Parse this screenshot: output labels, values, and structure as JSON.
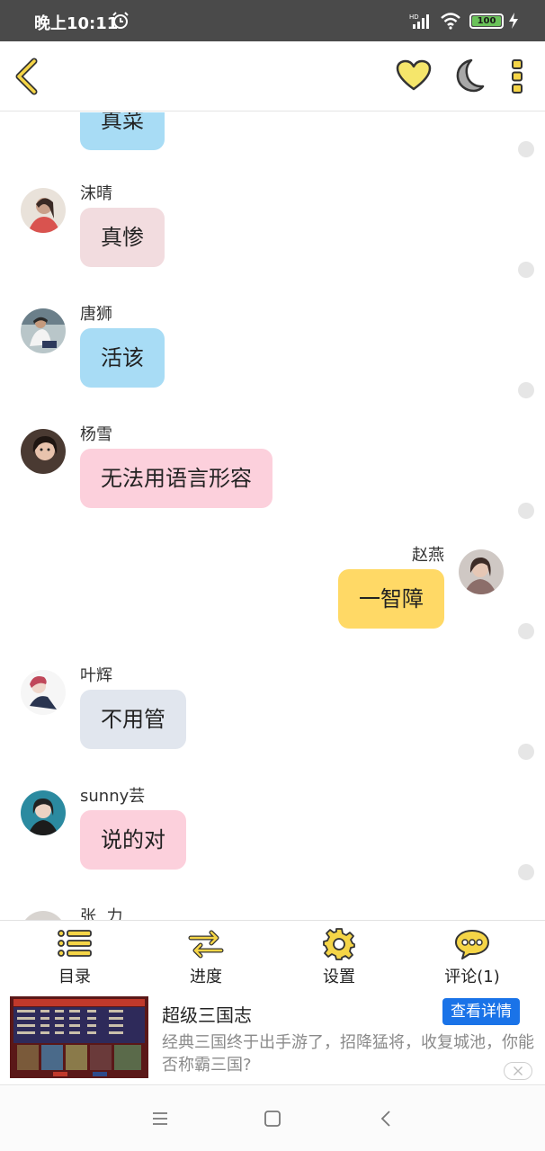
{
  "status_bar": {
    "time": "晚上10:11",
    "battery": "100",
    "battery_color": "#6ac259"
  },
  "app_bar": {
    "accent_color": "#f5d547",
    "icons": [
      "back-icon",
      "heart-icon",
      "moon-icon",
      "more-icon"
    ]
  },
  "chat": {
    "partial_top": {
      "text": "真菜",
      "color": "#a8dcf5"
    },
    "messages": [
      {
        "sender": "沫晴",
        "text": "真惨",
        "side": "left",
        "bubble_color": "#f2dcdf"
      },
      {
        "sender": "唐狮",
        "text": "活该",
        "side": "left",
        "bubble_color": "#a8dcf5"
      },
      {
        "sender": "杨雪",
        "text": "无法用语言形容",
        "side": "left",
        "bubble_color": "#fcd0dc"
      },
      {
        "sender": "赵燕",
        "text": "一智障",
        "side": "right",
        "bubble_color": "#ffd966"
      },
      {
        "sender": "叶辉",
        "text": "不用管",
        "side": "left",
        "bubble_color": "#e1e6ee"
      },
      {
        "sender": "sunny芸",
        "text": "说的对",
        "side": "left",
        "bubble_color": "#fcd0dc"
      }
    ],
    "partial_bottom_sender": "张  力"
  },
  "toolbar": {
    "items": [
      {
        "label": "目录",
        "icon": "list-icon"
      },
      {
        "label": "进度",
        "icon": "swap-arrows-icon"
      },
      {
        "label": "设置",
        "icon": "gear-icon"
      },
      {
        "label": "评论(1)",
        "icon": "comment-icon"
      }
    ]
  },
  "ad": {
    "title": "超级三国志",
    "button": "查看详情",
    "description": "经典三国终于出手游了，招降猛将，收复城池，你能否称霸三国?"
  },
  "nav_bar": {
    "icons": [
      "menu-icon",
      "home-icon",
      "back-nav-icon"
    ]
  }
}
